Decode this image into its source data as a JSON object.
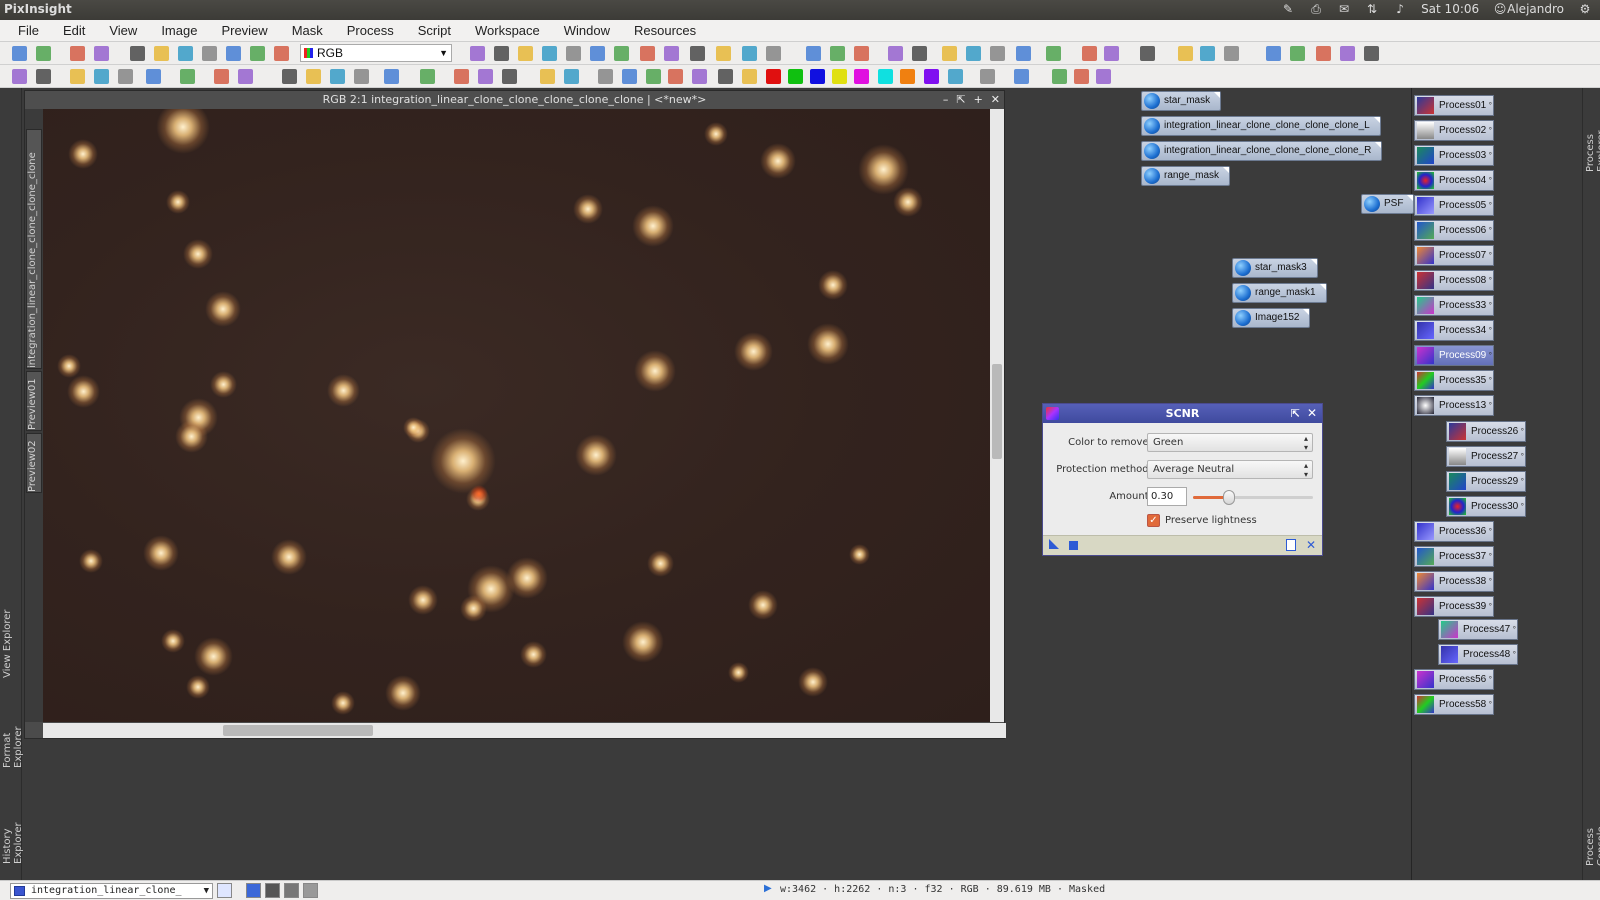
{
  "os_bar": {
    "app_title": "PixInsight",
    "clock": "Sat 10:06",
    "user": "Alejandro"
  },
  "menu": [
    "File",
    "Edit",
    "View",
    "Image",
    "Preview",
    "Mask",
    "Process",
    "Script",
    "Workspace",
    "Window",
    "Resources"
  ],
  "toolbar": {
    "color_space": "RGB"
  },
  "image_window": {
    "title": "RGB 2:1 integration_linear_clone_clone_clone_clone_clone | <*new*>",
    "side_tabs": [
      "integration_linear_clone_clone_clone_clone",
      "Preview01",
      "Preview02"
    ]
  },
  "left_dock_tabs": [
    "View Explorer",
    "Format Explorer",
    "History Explorer"
  ],
  "right_dock_tabs": [
    "Process Explorer",
    "Process Console"
  ],
  "image_icons": [
    "star_mask",
    "integration_linear_clone_clone_clone_clone_L",
    "integration_linear_clone_clone_clone_clone_R",
    "range_mask",
    "PSF",
    "star_mask3",
    "range_mask1",
    "Image152"
  ],
  "process_icons": [
    "Process01",
    "Process02",
    "Process03",
    "Process04",
    "Process05",
    "Process06",
    "Process07",
    "Process08",
    "Process33",
    "Process34",
    "Process09",
    "Process35",
    "Process13",
    "Process26",
    "Process27",
    "Process29",
    "Process30",
    "Process36",
    "Process37",
    "Process38",
    "Process39",
    "Process47",
    "Process48",
    "Process56",
    "Process58"
  ],
  "scnr": {
    "title": "SCNR",
    "color_label": "Color to remove:",
    "color_value": "Green",
    "protection_label": "Protection method:",
    "protection_value": "Average Neutral",
    "amount_label": "Amount:",
    "amount_value": "0.30",
    "amount": 0.3,
    "preserve_label": "Preserve lightness",
    "preserve_checked": true
  },
  "status_bar": {
    "view_name": "integration_linear_clone_",
    "info": "w:3462 · h:2262 · n:3 · f32 · RGB · 89.619 MB · Masked"
  },
  "colors": {
    "accent": "#e16a3a",
    "dialog_title": "#4b55aa",
    "icon_blue": "#1d6fd1"
  }
}
